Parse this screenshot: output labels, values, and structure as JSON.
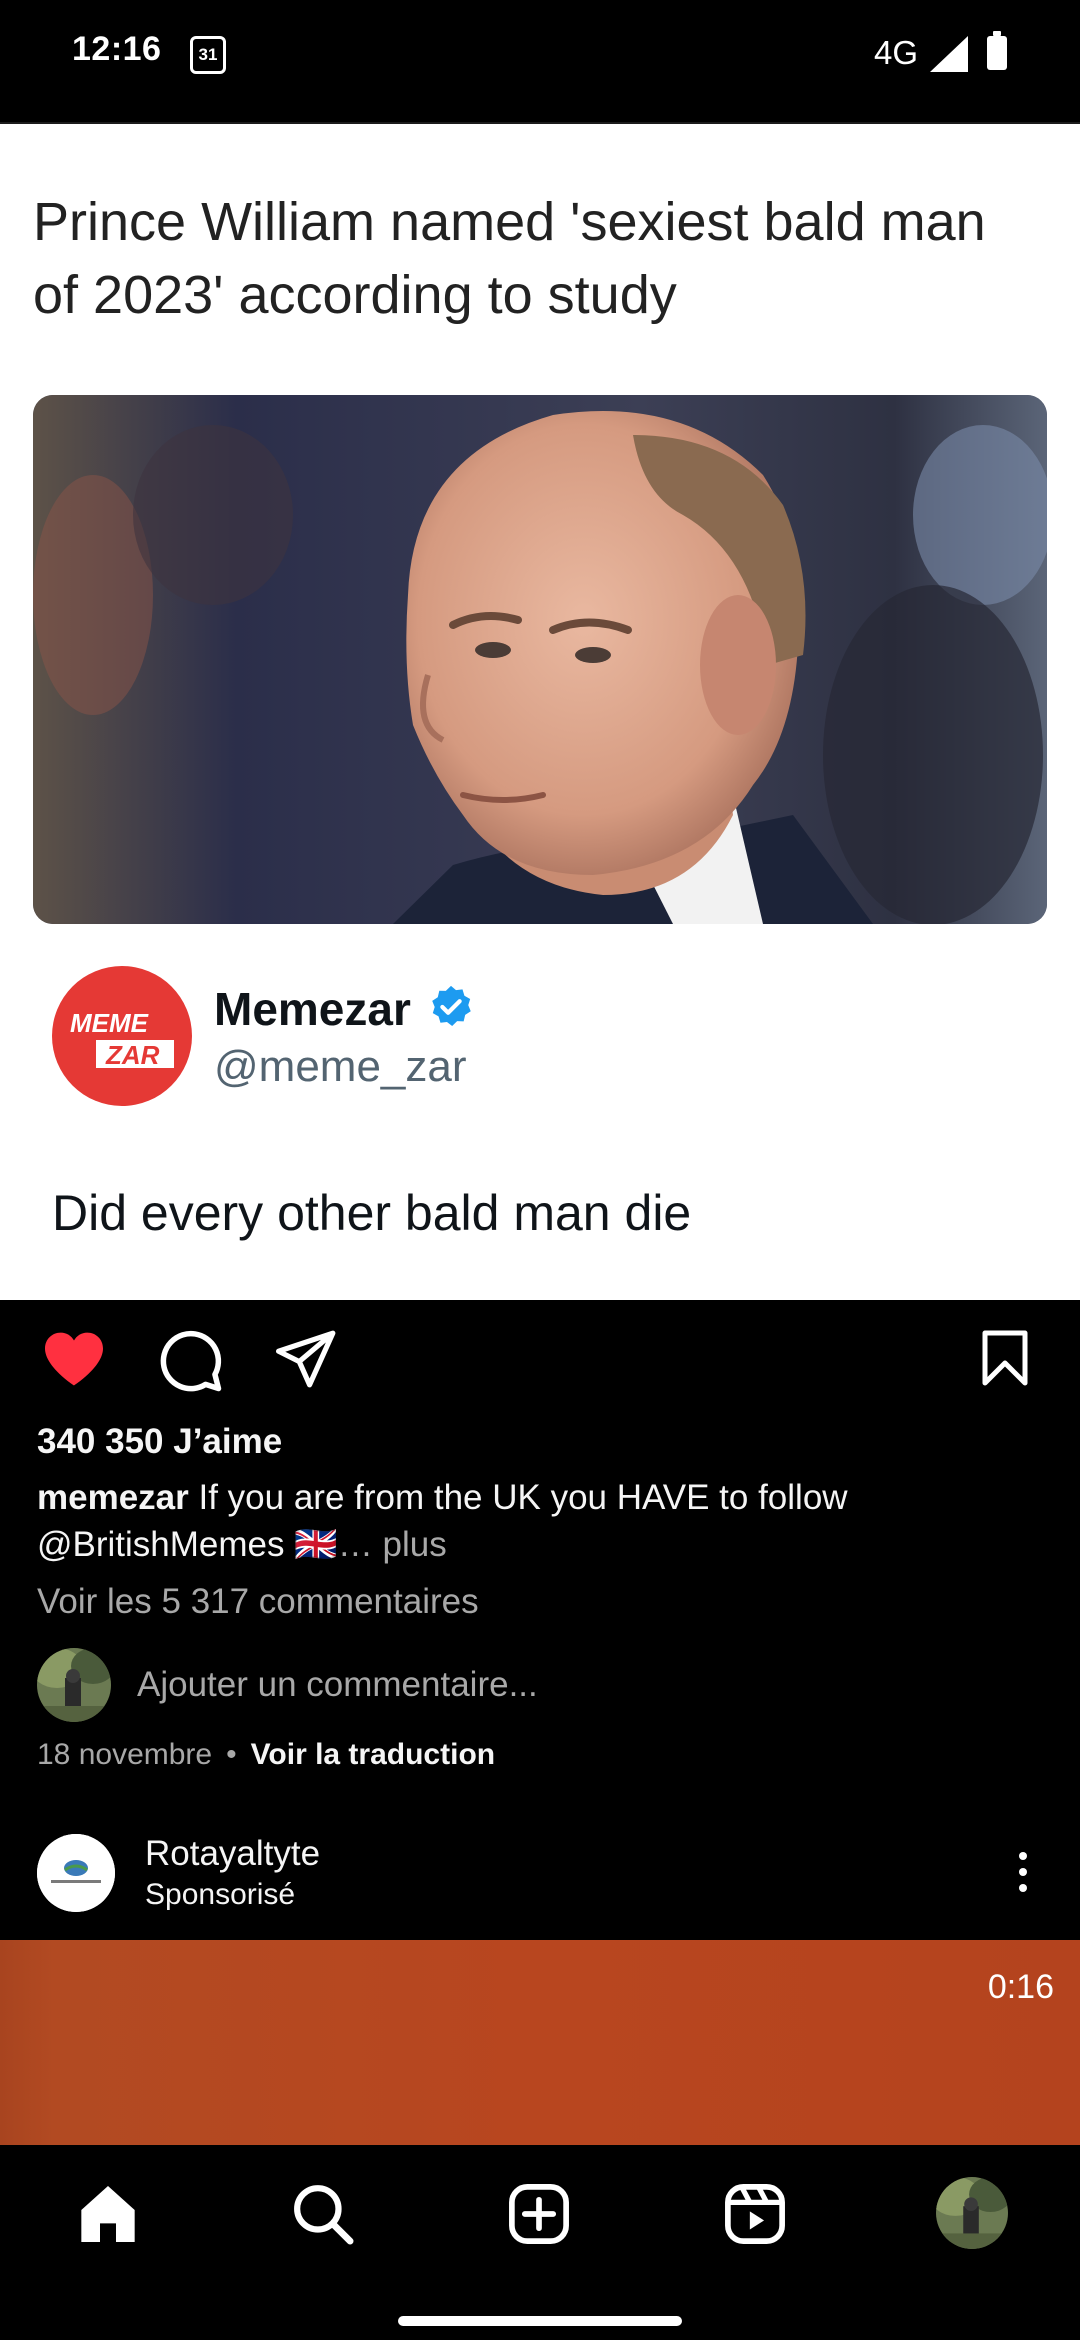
{
  "status_bar": {
    "time": "12:16",
    "calendar_day": "31",
    "network": "4G"
  },
  "meme": {
    "headline": "Prince William named 'sexiest bald man of 2023' according to study",
    "tweet": {
      "name": "Memezar",
      "handle": "@meme_zar",
      "text": "Did every other bald man die",
      "logo_text": [
        "MEME",
        "ZAR"
      ]
    }
  },
  "post": {
    "likes": "340 350 J’aime",
    "caption_user": "memezar",
    "caption_text": " If you are from the UK you HAVE to follow @BritishMemes 🇬🇧",
    "caption_more": "… plus",
    "comments_link": "Voir les 5 317 commentaires",
    "comment_placeholder": "Ajouter un commentaire...",
    "date": "18 novembre",
    "translate": "Voir la traduction",
    "liked": true
  },
  "sponsored": {
    "name": "Rotayaltyte",
    "label": "Sponsorisé",
    "video_time": "0:16"
  },
  "icons": {
    "like": "heart-icon",
    "comment": "comment-icon",
    "share": "send-icon",
    "save": "bookmark-icon",
    "nav": [
      "home-icon",
      "search-icon",
      "create-icon",
      "reels-icon",
      "profile-avatar"
    ]
  },
  "colors": {
    "like_red": "#ff3040",
    "verified_blue": "#1d9bf0",
    "memezar_red": "#e53935"
  }
}
